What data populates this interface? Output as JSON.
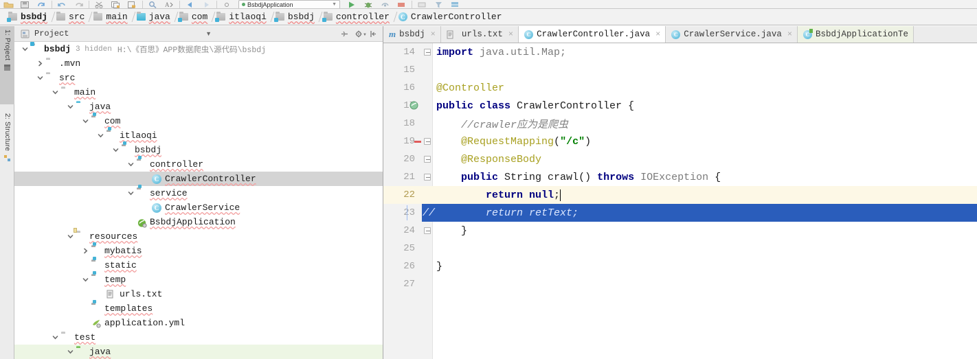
{
  "toolbar": {
    "icons": [
      "folder-open-icon",
      "save-all-icon",
      "sync-icon",
      "undo-icon",
      "redo-icon",
      "cut-icon",
      "copy-icon",
      "paste-icon",
      "find-icon",
      "replace-icon",
      "back-icon",
      "forward-icon",
      "settings-icon"
    ],
    "run_config_label": "BsbdjApplication",
    "run_icons": [
      "run-icon",
      "debug-icon",
      "run-coverage-icon",
      "stop-icon",
      "build-icon",
      "search-everywhere-icon",
      "project-structure-icon"
    ]
  },
  "breadcrumb": [
    {
      "label": "bsbdj",
      "icon": "module-icon"
    },
    {
      "label": "src",
      "icon": "folder-icon"
    },
    {
      "label": "main",
      "icon": "folder-icon"
    },
    {
      "label": "java",
      "icon": "source-folder-icon"
    },
    {
      "label": "com",
      "icon": "package-icon"
    },
    {
      "label": "itlaoqi",
      "icon": "package-icon"
    },
    {
      "label": "bsbdj",
      "icon": "package-icon"
    },
    {
      "label": "controller",
      "icon": "package-icon"
    },
    {
      "label": "CrawlerController",
      "icon": "class-icon"
    }
  ],
  "tool_strip": [
    {
      "label": "1: Project",
      "icon": "project-icon",
      "active": true
    },
    {
      "label": "2: Structure",
      "icon": "structure-icon",
      "active": false
    }
  ],
  "project_panel": {
    "title": "Project",
    "title_icon": "project-view-icon",
    "header_icons": [
      "collapse-all-icon",
      "settings-gear-icon",
      "hide-panel-icon",
      "chevron-down-icon"
    ],
    "tree": [
      {
        "label": "bsbdj",
        "icon": "module-icon",
        "indent": 0,
        "arrow": "down",
        "bold": true,
        "meta": "3 hidden",
        "path": "H:\\《百思》APP数据爬虫\\源代码\\bsbdj",
        "selected": false,
        "green": false
      },
      {
        "label": ".mvn",
        "icon": "folder-gray-icon",
        "indent": 1,
        "arrow": "right",
        "bold": false,
        "meta": "",
        "path": "",
        "selected": false,
        "green": false
      },
      {
        "label": "src",
        "icon": "folder-gray-icon",
        "indent": 1,
        "arrow": "down",
        "bold": false,
        "meta": "",
        "path": "",
        "selected": false,
        "green": false
      },
      {
        "label": "main",
        "icon": "folder-gray-icon",
        "indent": 2,
        "arrow": "down",
        "bold": false,
        "meta": "",
        "path": "",
        "selected": false,
        "green": false
      },
      {
        "label": "java",
        "icon": "source-root-icon",
        "indent": 3,
        "arrow": "down",
        "bold": false,
        "meta": "",
        "path": "",
        "selected": false,
        "green": false
      },
      {
        "label": "com",
        "icon": "package-icon",
        "indent": 4,
        "arrow": "down",
        "bold": false,
        "meta": "",
        "path": "",
        "selected": false,
        "green": false
      },
      {
        "label": "itlaoqi",
        "icon": "package-icon",
        "indent": 5,
        "arrow": "down",
        "bold": false,
        "meta": "",
        "path": "",
        "selected": false,
        "green": false
      },
      {
        "label": "bsbdj",
        "icon": "package-icon",
        "indent": 6,
        "arrow": "down",
        "bold": false,
        "meta": "",
        "path": "",
        "selected": false,
        "green": false
      },
      {
        "label": "controller",
        "icon": "package-icon",
        "indent": 7,
        "arrow": "down",
        "bold": false,
        "meta": "",
        "path": "",
        "selected": false,
        "green": false
      },
      {
        "label": "CrawlerController",
        "icon": "class-icon",
        "indent": 8,
        "arrow": "none",
        "bold": false,
        "meta": "",
        "path": "",
        "selected": true,
        "green": false
      },
      {
        "label": "service",
        "icon": "package-icon",
        "indent": 7,
        "arrow": "down",
        "bold": false,
        "meta": "",
        "path": "",
        "selected": false,
        "green": false
      },
      {
        "label": "CrawlerService",
        "icon": "class-icon",
        "indent": 8,
        "arrow": "none",
        "bold": false,
        "meta": "",
        "path": "",
        "selected": false,
        "green": false
      },
      {
        "label": "BsbdjApplication",
        "icon": "spring-boot-icon",
        "indent": 7,
        "arrow": "none",
        "bold": false,
        "meta": "",
        "path": "",
        "selected": false,
        "green": false
      },
      {
        "label": "resources",
        "icon": "resource-root-icon",
        "indent": 3,
        "arrow": "down",
        "bold": false,
        "meta": "",
        "path": "",
        "selected": false,
        "green": false
      },
      {
        "label": "mybatis",
        "icon": "package-icon",
        "indent": 4,
        "arrow": "right",
        "bold": false,
        "meta": "",
        "path": "",
        "selected": false,
        "green": false
      },
      {
        "label": "static",
        "icon": "package-icon",
        "indent": 4,
        "arrow": "none",
        "bold": false,
        "meta": "",
        "path": "",
        "selected": false,
        "green": false
      },
      {
        "label": "temp",
        "icon": "package-icon",
        "indent": 4,
        "arrow": "down",
        "bold": false,
        "meta": "",
        "path": "",
        "selected": false,
        "green": false
      },
      {
        "label": "urls.txt",
        "icon": "text-file-icon",
        "indent": 5,
        "arrow": "none",
        "bold": false,
        "meta": "",
        "path": "",
        "selected": false,
        "green": false
      },
      {
        "label": "templates",
        "icon": "package-icon",
        "indent": 4,
        "arrow": "none",
        "bold": false,
        "meta": "",
        "path": "",
        "selected": false,
        "green": false
      },
      {
        "label": "application.yml",
        "icon": "yaml-file-icon",
        "indent": 4,
        "arrow": "none",
        "bold": false,
        "meta": "",
        "path": "",
        "selected": false,
        "green": false
      },
      {
        "label": "test",
        "icon": "folder-gray-icon",
        "indent": 2,
        "arrow": "down",
        "bold": false,
        "meta": "",
        "path": "",
        "selected": false,
        "green": false
      },
      {
        "label": "java",
        "icon": "test-root-icon",
        "indent": 3,
        "arrow": "down",
        "bold": false,
        "meta": "",
        "path": "",
        "selected": false,
        "green": true
      }
    ]
  },
  "editor": {
    "tabs": [
      {
        "label": "bsbdj",
        "icon": "maven-icon",
        "active": false,
        "closable": true,
        "greenish": false
      },
      {
        "label": "urls.txt",
        "icon": "text-file-icon",
        "active": false,
        "closable": true,
        "greenish": false
      },
      {
        "label": "CrawlerController.java",
        "icon": "class-icon",
        "active": true,
        "closable": true,
        "greenish": false
      },
      {
        "label": "CrawlerService.java",
        "icon": "class-icon",
        "active": false,
        "closable": true,
        "greenish": false
      },
      {
        "label": "BsbdjApplicationTe",
        "icon": "test-class-icon",
        "active": false,
        "closable": false,
        "greenish": true
      }
    ],
    "lines": [
      {
        "num": "14",
        "state": "normal",
        "fold": "minus",
        "tokens": [
          {
            "t": "import ",
            "c": "kw"
          },
          {
            "t": "java.util.Map;",
            "c": "typ"
          }
        ]
      },
      {
        "num": "15",
        "state": "normal",
        "fold": "none",
        "tokens": []
      },
      {
        "num": "16",
        "state": "normal",
        "fold": "none",
        "tokens": [
          {
            "t": "@Controller",
            "c": "ann"
          }
        ]
      },
      {
        "num": "17",
        "state": "normal",
        "fold": "none",
        "bookmark": "spring-bean-gutter-icon",
        "tokens": [
          {
            "t": "public class ",
            "c": "kw"
          },
          {
            "t": "CrawlerController {",
            "c": "plain"
          }
        ]
      },
      {
        "num": "18",
        "state": "normal",
        "fold": "none",
        "tokens": [
          {
            "t": "    //crawler应为是爬虫",
            "c": "cmt"
          }
        ]
      },
      {
        "num": "19",
        "state": "normal",
        "fold": "minus",
        "mark": true,
        "tokens": [
          {
            "t": "    ",
            "c": "plain"
          },
          {
            "t": "@RequestMapping",
            "c": "ann"
          },
          {
            "t": "(",
            "c": "plain"
          },
          {
            "t": "\"/c\"",
            "c": "str"
          },
          {
            "t": ")",
            "c": "plain"
          }
        ]
      },
      {
        "num": "20",
        "state": "normal",
        "fold": "minus",
        "tokens": [
          {
            "t": "    ",
            "c": "plain"
          },
          {
            "t": "@ResponseBody",
            "c": "ann"
          }
        ]
      },
      {
        "num": "21",
        "state": "normal",
        "fold": "minus",
        "tokens": [
          {
            "t": "    public ",
            "c": "kw"
          },
          {
            "t": "String ",
            "c": "plain"
          },
          {
            "t": "crawl",
            "c": "plain"
          },
          {
            "t": "() ",
            "c": "plain"
          },
          {
            "t": "throws ",
            "c": "kw"
          },
          {
            "t": "IOException ",
            "c": "typ"
          },
          {
            "t": "{",
            "c": "plain"
          }
        ]
      },
      {
        "num": "22",
        "state": "caret",
        "fold": "none",
        "caret": true,
        "tokens": [
          {
            "t": "        ",
            "c": "plain"
          },
          {
            "t": "return null",
            "c": "kw"
          },
          {
            "t": ";",
            "c": "plain"
          }
        ]
      },
      {
        "num": "23",
        "state": "selected",
        "fold": "none",
        "prefix": "//",
        "tokens": [
          {
            "t": "        return retText;",
            "c": "cmt-sel"
          }
        ]
      },
      {
        "num": "24",
        "state": "normal",
        "fold": "minus",
        "tokens": [
          {
            "t": "    }",
            "c": "plain"
          }
        ]
      },
      {
        "num": "25",
        "state": "normal",
        "fold": "none",
        "tokens": []
      },
      {
        "num": "26",
        "state": "normal",
        "fold": "none",
        "tokens": [
          {
            "t": "}",
            "c": "plain"
          }
        ]
      },
      {
        "num": "27",
        "state": "normal",
        "fold": "none",
        "tokens": []
      }
    ]
  },
  "colors": {
    "selection_blue": "#2a5dbb",
    "caret_row": "#fdf8e6",
    "tree_selected": "#d4d4d4",
    "test_root_green": "#edf6e4",
    "keyword": "#000080",
    "annotation": "#a8a020",
    "string": "#008000",
    "comment": "#808080"
  }
}
